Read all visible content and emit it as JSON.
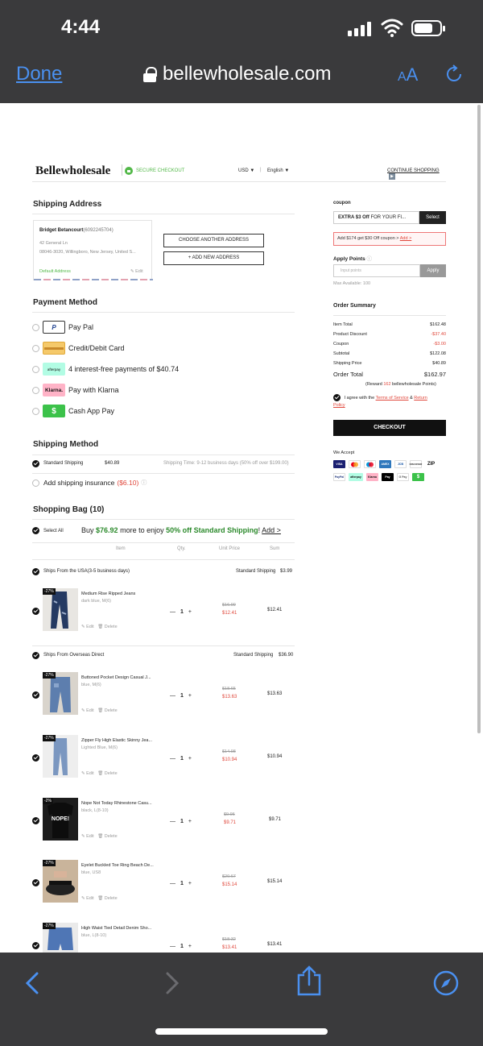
{
  "status": {
    "time": "4:44"
  },
  "browser": {
    "done": "Done",
    "url": "bellewholesale.com",
    "aa_small": "A",
    "aa_big": "A"
  },
  "site": {
    "logo": "Bellewholesale",
    "secure": "SECURE CHECKOUT",
    "currency": "USD ▼",
    "language": "English ▼",
    "continue": "CONTINUE SHOPPING"
  },
  "shipping_address": {
    "title": "Shipping Address",
    "name": "Bridget Betancourt",
    "phone": "(6092245704)",
    "line1": "42 General Ln",
    "line2": "08046-3020, Willingboro, New Jersey, United S...",
    "default": "Default Address",
    "edit": "Edit",
    "choose": "CHOOSE ANOTHER ADDRESS",
    "add": "+ ADD NEW ADDRESS"
  },
  "payment": {
    "title": "Payment Method",
    "options": [
      {
        "label": "Pay Pal",
        "logo": "P"
      },
      {
        "label": "Credit/Debit Card",
        "logo": ""
      },
      {
        "label": "4 interest-free payments of $40.74",
        "logo": "afterpay"
      },
      {
        "label": "Pay with Klarna",
        "logo": "Klarna."
      },
      {
        "label": "Cash App Pay",
        "logo": "$"
      }
    ]
  },
  "shipping_method": {
    "title": "Shipping Method",
    "name": "Standard Shipping",
    "price": "$40.89",
    "time": "Shipping Time: 9-12 business days (50% off over $199.00)",
    "insurance": "Add shipping insurance",
    "insurance_price": "($6.10)"
  },
  "bag": {
    "title": "Shopping Bag (10)",
    "select_all": "Select All",
    "promo_pre": "Buy",
    "promo_amount": "$76.92",
    "promo_mid": "more to enjoy",
    "promo_deal": "50% off Standard Shipping",
    "promo_excl": "!",
    "promo_link": "Add >",
    "cols": {
      "item": "Item",
      "qty": "Qty.",
      "unit": "Unit Price",
      "sum": "Sum"
    },
    "edit": "Edit",
    "delete": "Delete",
    "groups": [
      {
        "label": "Ships From the USA(3-5 business days)",
        "ship": "Standard Shipping",
        "ship_price": "$3.99"
      },
      {
        "label": "Ships From Overseas Direct",
        "ship": "Standard Shipping",
        "ship_price": "$36.90"
      }
    ],
    "items": [
      {
        "tag": "-27%",
        "name": "Medium Rise Ripped Jeans",
        "attr": "dark blue, M(6)",
        "qty": "1",
        "old": "$16.99",
        "price": "$12.41",
        "sum": "$12.41"
      },
      {
        "tag": "-27%",
        "name": "Buttoned Pocket Design Casual J...",
        "attr": "blue, M(6)",
        "qty": "1",
        "old": "$18.65",
        "price": "$13.63",
        "sum": "$13.63"
      },
      {
        "tag": "-27%",
        "name": "Zipper Fly High Elastic Skinny Jea...",
        "attr": "Lighted Blue, M(6)",
        "qty": "1",
        "old": "$14.98",
        "price": "$10.94",
        "sum": "$10.94"
      },
      {
        "tag": "-2%",
        "name": "Nope Not Today Rhinestone Casu...",
        "attr": "black, L(8-10)",
        "qty": "1",
        "old": "$9.95",
        "price": "$9.71",
        "sum": "$9.71",
        "shirt_text": "NOPE!"
      },
      {
        "tag": "-27%",
        "name": "Eyelet Buckled Toe Ring Beach De...",
        "attr": "blue, US8",
        "qty": "1",
        "old": "$20.67",
        "price": "$15.14",
        "sum": "$15.14"
      },
      {
        "tag": "-27%",
        "name": "High Waist Tied Detail Denim Sho...",
        "attr": "blue, L(8-10)",
        "qty": "1",
        "old": "$18.32",
        "price": "$13.41",
        "sum": "$13.41"
      }
    ]
  },
  "sidebar": {
    "coupon_label": "coupon",
    "coupon_bold": "EXTRA $3 Off",
    "coupon_rest": " FOR YOUR FI...",
    "coupon_btn": "Select",
    "coupon_tip_pre": "Add $174 get $30 Off coupon >",
    "coupon_tip_link": "Add >",
    "points_title": "Apply Points",
    "points_placeholder": "Input points",
    "points_btn": "Apply",
    "points_max": "Max Available: 100",
    "summary_title": "Order Summary",
    "rows": [
      {
        "label": "Item Total",
        "value": "$162.48",
        "red": false
      },
      {
        "label": "Product Discount",
        "value": "-$37.40",
        "red": true
      },
      {
        "label": "Coupon",
        "value": "-$3.00",
        "red": true
      },
      {
        "label": "Subtotal",
        "value": "$122.08",
        "red": false
      },
      {
        "label": "Shipping Price",
        "value": "$40.89",
        "red": false
      }
    ],
    "order_total_label": "Order Total",
    "order_total": "$162.97",
    "reward_pre": "(Reward",
    "reward_pts": "162",
    "reward_post": "bellewholesale Points)",
    "agree_pre": "I agree with the",
    "tos": "Terms of Service",
    "amp": "&",
    "return": "Return",
    "policy": "Policy",
    "checkout": "CHECKOUT",
    "we_accept": "We Accept",
    "accept_row1": [
      "VISA",
      "MC",
      "MC",
      "AMEX",
      "JCB",
      "DISCOVER",
      "ZIP"
    ],
    "accept_row2": [
      "PayPal",
      "afterpay",
      "Klarna",
      "Pay",
      "G Pay",
      "$"
    ]
  },
  "colors": {
    "green": "#52b848",
    "red": "#e0473b",
    "link_blue": "#4a90f0",
    "chrome": "#3a3a3c"
  }
}
